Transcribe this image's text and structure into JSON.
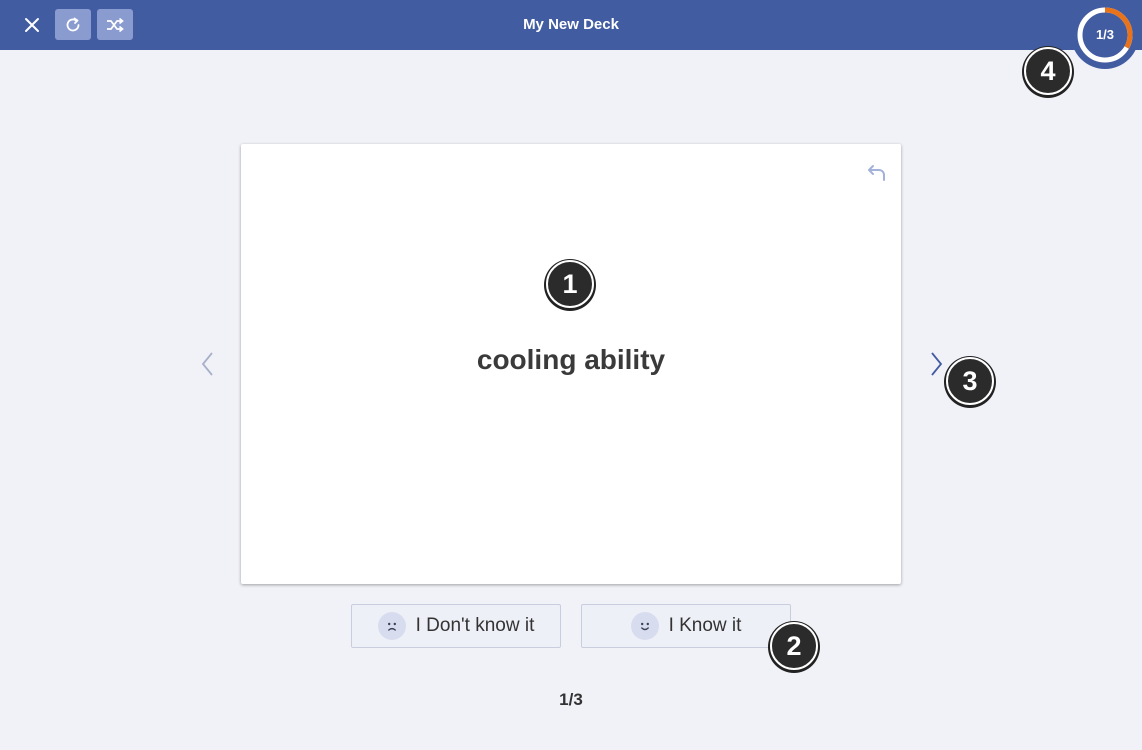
{
  "header": {
    "title": "My New Deck",
    "progress_text": "1/3",
    "progress_fraction": 0.333,
    "ring_color": "#ffffff",
    "progress_color": "#e8731b",
    "icons": [
      "close-icon",
      "restart-icon",
      "shuffle-icon"
    ]
  },
  "card": {
    "term": "cooling ability",
    "icons": [
      "flip-icon"
    ]
  },
  "navigation": {
    "icons": [
      "chevron-left-icon",
      "chevron-right-icon"
    ]
  },
  "actions": {
    "dont_know_label": "I Don't know it",
    "know_label": "I Know it",
    "icons": [
      "sad-face-icon",
      "smile-face-icon"
    ]
  },
  "footer": {
    "counter": "1/3"
  },
  "annotations": {
    "badge_1": "1",
    "badge_2": "2",
    "badge_3": "3",
    "badge_4": "4"
  },
  "colors": {
    "header_bg": "#425ca1",
    "page_bg": "#f1f2f8",
    "accent_blue": "#425ca1",
    "progress_orange": "#e8731b"
  }
}
